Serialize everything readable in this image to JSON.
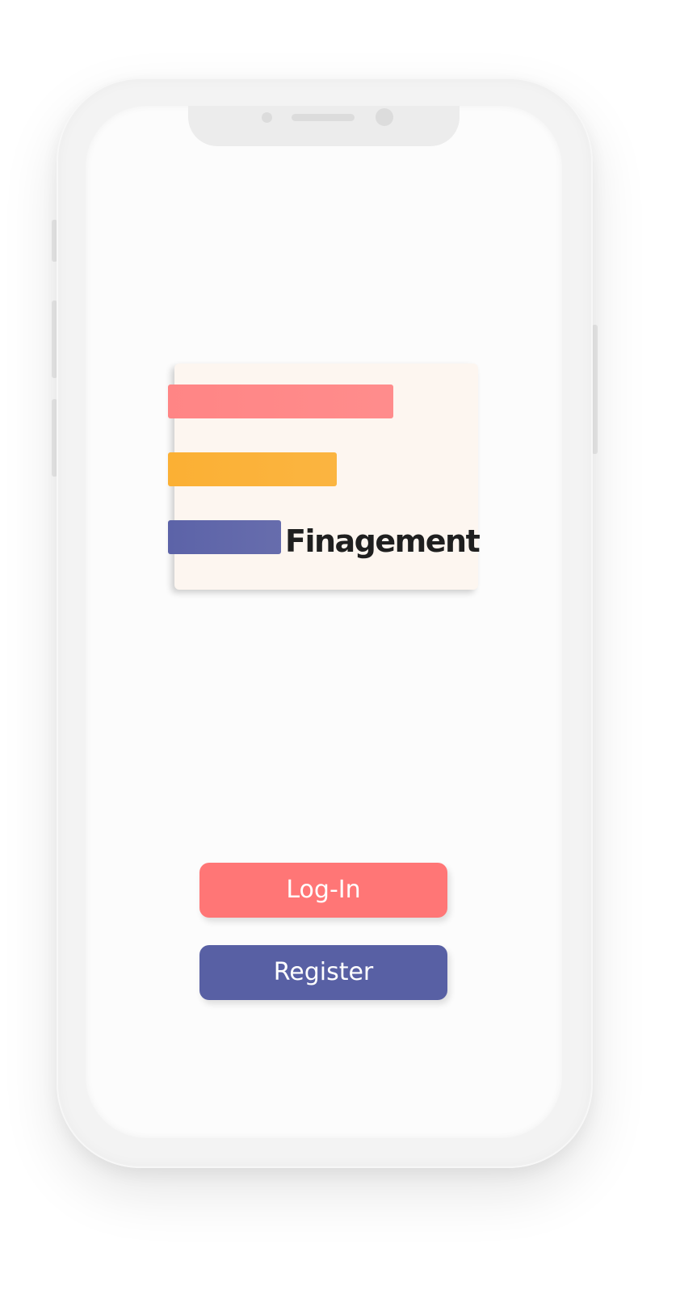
{
  "app": {
    "brand_name": "Finagement"
  },
  "logo": {
    "bar_colors": [
      "#ff8585",
      "#fbb034",
      "#5c63a8"
    ]
  },
  "actions": {
    "login_label": "Log-In",
    "register_label": "Register"
  },
  "colors": {
    "login": "#ff7676",
    "register": "#5860a4",
    "card_background": "#fdf6f0",
    "screen_background": "#fcfcfc"
  },
  "icons": {
    "front_sensor_dot": "sensor-dot-icon",
    "speaker": "speaker-grille-icon",
    "camera": "front-camera-icon"
  }
}
